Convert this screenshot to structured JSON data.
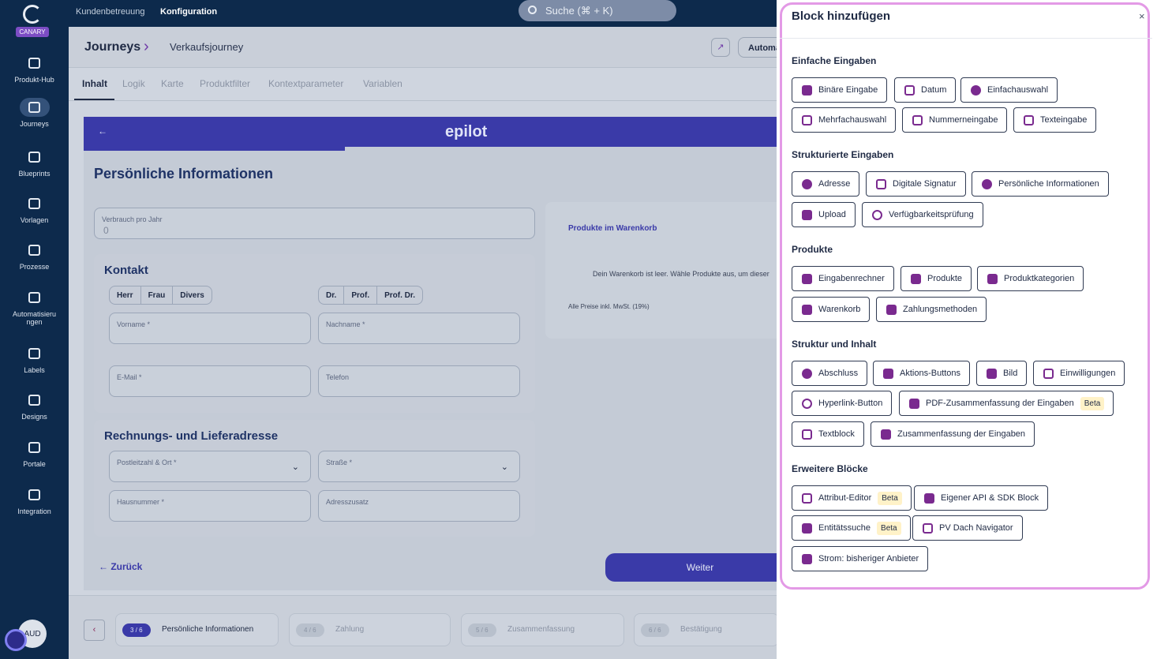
{
  "app": {
    "canary": "CANARY",
    "avatar": "AUD"
  },
  "nav": [
    {
      "label": "Produkt-Hub",
      "icon": "product-hub-icon"
    },
    {
      "label": "Journeys",
      "icon": "journeys-icon"
    },
    {
      "label": "Blueprints",
      "icon": "blueprints-icon"
    },
    {
      "label": "Vorlagen",
      "icon": "folder-icon"
    },
    {
      "label": "Prozesse",
      "icon": "processes-icon"
    },
    {
      "label": "Automatisieru ngen",
      "icon": "bolt-icon"
    },
    {
      "label": "Labels",
      "icon": "label-icon"
    },
    {
      "label": "Designs",
      "icon": "palette-icon"
    },
    {
      "label": "Portale",
      "icon": "globe-icon"
    },
    {
      "label": "Integration",
      "icon": "webhook-icon"
    }
  ],
  "topbar": {
    "crumb1": "Kundenbetreuung",
    "crumb2": "Konfiguration",
    "search_placeholder": "Suche (⌘ + K)"
  },
  "header": {
    "title": "Journeys",
    "sep": "›",
    "journey": "Verkaufsjourney",
    "auto_btn": "Automa"
  },
  "tabs": [
    "Inhalt",
    "Logik",
    "Karte",
    "Produktfilter",
    "Kontextparameter",
    "Variablen"
  ],
  "journey": {
    "brand": "epilot",
    "title": "Persönliche Informationen",
    "verbrauch_label": "Verbrauch pro Jahr",
    "verbrauch_value": "0",
    "kontakt": "Kontakt",
    "salutations": [
      "Herr",
      "Frau",
      "Divers"
    ],
    "titles": [
      "Dr.",
      "Prof.",
      "Prof. Dr."
    ],
    "vorname": "Vorname *",
    "nachname": "Nachname *",
    "email": "E-Mail *",
    "telefon": "Telefon",
    "address_title": "Rechnungs- und Lieferadresse",
    "plz": "Postleitzahl & Ort *",
    "strasse": "Straße *",
    "hausnummer": "Hausnummer *",
    "adresszusatz": "Adresszusatz",
    "cart_title": "Produkte im Warenkorb",
    "cart_empty": "Dein Warenkorb ist leer. Wähle Produkte aus, um dieser",
    "cart_prices": "Alle Preise inkl. MwSt. (19%)",
    "back": "← Zurück",
    "next": "Weiter"
  },
  "steps": [
    {
      "num": "3 / 6",
      "label": "Persönliche Informationen"
    },
    {
      "num": "4 / 6",
      "label": "Zahlung"
    },
    {
      "num": "5 / 6",
      "label": "Zusammenfassung"
    },
    {
      "num": "6 / 6",
      "label": "Bestätigung"
    }
  ],
  "panel": {
    "title": "Block hinzufügen",
    "close": "×",
    "sections": [
      {
        "title": "Einfache Eingaben",
        "items": [
          "Binäre Eingabe",
          "Datum",
          "Einfachauswahl",
          "Mehrfachauswahl",
          "Nummerneingabe",
          "Texteingabe"
        ]
      },
      {
        "title": "Strukturierte Eingaben",
        "items": [
          "Adresse",
          "Digitale Signatur",
          "Persönliche Informationen",
          "Upload",
          "Verfügbarkeitsprüfung"
        ]
      },
      {
        "title": "Produkte",
        "items": [
          "Eingabenrechner",
          "Produkte",
          "Produktkategorien",
          "Warenkorb",
          "Zahlungsmethoden"
        ]
      },
      {
        "title": "Struktur und Inhalt",
        "items": [
          "Abschluss",
          "Aktions-Buttons",
          "Bild",
          "Einwilligungen",
          "Hyperlink-Button",
          "PDF-Zusammenfassung der Eingaben",
          "Textblock",
          "Zusammenfassung der Eingaben"
        ]
      },
      {
        "title": "Erweitere Blöcke",
        "items": [
          "Attribut-Editor",
          "Eigener API & SDK Block",
          "Entitätssuche",
          "PV Dach Navigator",
          "Strom: bisheriger Anbieter"
        ]
      }
    ],
    "beta": "Beta"
  },
  "colors": {
    "nav": "#0d2a4c",
    "accent": "#3a3aa8",
    "icon": "#7a2a8f",
    "highlight": "#e39ae6"
  }
}
